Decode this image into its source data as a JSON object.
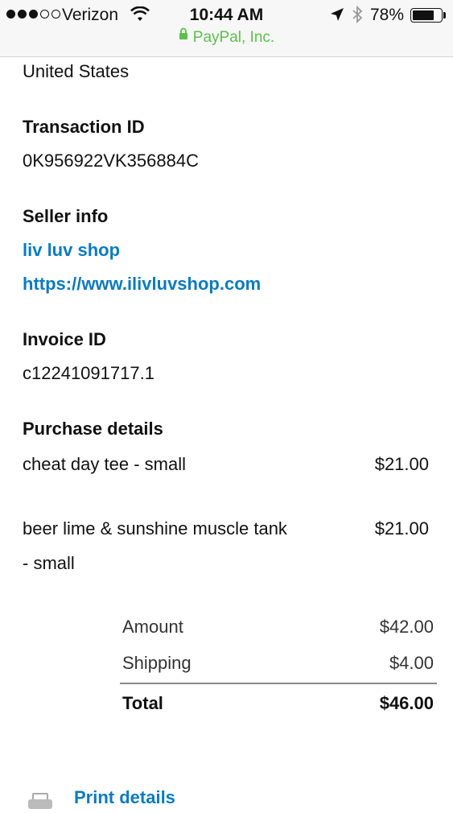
{
  "status_bar": {
    "carrier": "Verizon",
    "time": "10:44 AM",
    "battery_percent": "78%",
    "battery_level": 0.78,
    "url": "PayPal, Inc."
  },
  "address": {
    "country": "United States"
  },
  "transaction": {
    "heading": "Transaction ID",
    "value": "0K956922VK356884C"
  },
  "seller": {
    "heading": "Seller info",
    "name": "liv luv shop",
    "website": "https://www.ilivluvshop.com"
  },
  "invoice": {
    "heading": "Invoice ID",
    "value": "c12241091717.1"
  },
  "purchase": {
    "heading": "Purchase details",
    "items": [
      {
        "name": "cheat day tee - small",
        "price": "$21.00"
      },
      {
        "name_line1": "beer lime & sunshine muscle tank",
        "name_line2": "- small",
        "price": "$21.00"
      }
    ]
  },
  "summary": {
    "amount_label": "Amount",
    "amount_value": "$42.00",
    "shipping_label": "Shipping",
    "shipping_value": "$4.00",
    "total_label": "Total",
    "total_value": "$46.00"
  },
  "actions": {
    "print_label": "Print details"
  }
}
